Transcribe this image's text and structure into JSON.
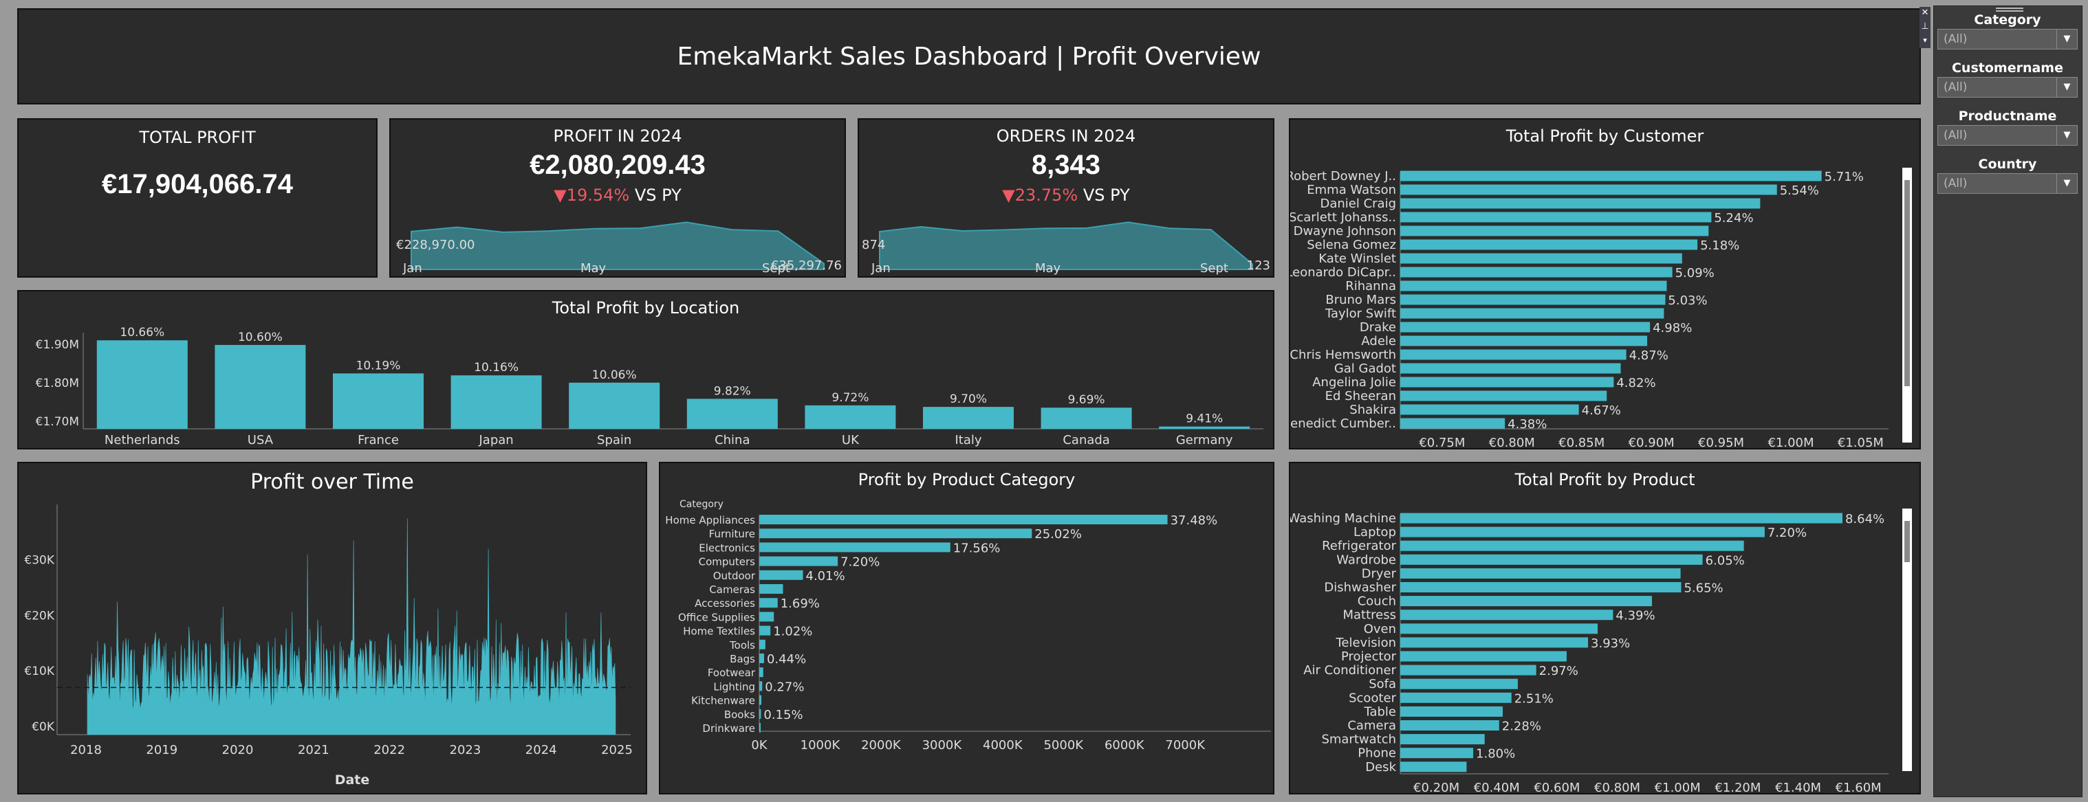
{
  "header": {
    "title": "EmekaMarkt Sales Dashboard | Profit Overview"
  },
  "kpis": {
    "total_profit": {
      "label": "TOTAL PROFIT",
      "value": "€17,904,066.74"
    },
    "profit_2024": {
      "label": "PROFIT IN 2024",
      "value": "€2,080,209.43",
      "delta": "▼19.54%",
      "delta_suffix": "VS PY",
      "start_label": "€228,970.00",
      "end_label": "€35,297.76",
      "axis": [
        "Jan",
        "May",
        "Sept"
      ]
    },
    "orders_2024": {
      "label": "ORDERS IN 2024",
      "value": "8,343",
      "delta": "▼23.75%",
      "delta_suffix": "VS PY",
      "start_label": "874",
      "end_label": "123",
      "axis": [
        "Jan",
        "May",
        "Sept"
      ]
    }
  },
  "location_chart": {
    "title": "Total Profit by Location"
  },
  "customer_chart": {
    "title": "Total Profit by Customer"
  },
  "time_chart": {
    "title": "Profit over Time",
    "xlabel": "Date"
  },
  "category_chart": {
    "title": "Profit by Product Category",
    "header": "Category"
  },
  "product_chart": {
    "title": "Total Profit by Product"
  },
  "filters": {
    "category": {
      "label": "Category",
      "value": "(All)"
    },
    "customer": {
      "label": "Customername",
      "value": "(All)"
    },
    "product": {
      "label": "Productname",
      "value": "(All)"
    },
    "country": {
      "label": "Country",
      "value": "(All)"
    }
  },
  "colors": {
    "accent": "#45b9c8",
    "panel": "#2b2b2b",
    "down": "#ef5a64"
  },
  "chart_data": [
    {
      "id": "location",
      "type": "bar",
      "title": "Total Profit by Location",
      "categories": [
        "Netherlands",
        "USA",
        "France",
        "Japan",
        "Spain",
        "China",
        "UK",
        "Italy",
        "Canada",
        "Germany"
      ],
      "values": [
        1910000,
        1898000,
        1824000,
        1819000,
        1800000,
        1758000,
        1741000,
        1737000,
        1735000,
        1686000
      ],
      "labels": [
        "10.66%",
        "10.60%",
        "10.19%",
        "10.16%",
        "10.06%",
        "9.82%",
        "9.72%",
        "9.70%",
        "9.69%",
        "9.41%"
      ],
      "yticks": [
        "€1.70M",
        "€1.80M",
        "€1.90M"
      ],
      "ylim": [
        1680000,
        1930000
      ]
    },
    {
      "id": "customer",
      "type": "bar",
      "title": "Total Profit by Customer",
      "categories": [
        "Robert Downey J..",
        "Emma Watson",
        "Daniel Craig",
        "Scarlett Johanss..",
        "Dwayne Johnson",
        "Selena Gomez",
        "Kate Winslet",
        "Leonardo DiCapr..",
        "Rihanna",
        "Bruno Mars",
        "Taylor Swift",
        "Drake",
        "Adele",
        "Chris Hemsworth",
        "Gal Gadot",
        "Angelina Jolie",
        "Ed Sheeran",
        "Shakira",
        "Benedict Cumber.."
      ],
      "values": [
        1022000,
        990000,
        978000,
        943000,
        941000,
        933000,
        922000,
        915000,
        911000,
        910000,
        909000,
        899000,
        897000,
        882000,
        878000,
        873000,
        868000,
        848000,
        795000
      ],
      "labels": [
        "5.71%",
        "5.54%",
        "",
        "5.24%",
        "",
        "5.18%",
        "",
        "5.09%",
        "",
        "5.03%",
        "",
        "4.98%",
        "",
        "4.87%",
        "",
        "4.82%",
        "",
        "4.67%",
        "4.38%"
      ],
      "xticks": [
        "€0.75M",
        "€0.80M",
        "€0.85M",
        "€0.90M",
        "€0.95M",
        "€1.00M",
        "€1.05M"
      ],
      "xlim": [
        0.72,
        1.07
      ]
    },
    {
      "id": "time",
      "type": "area",
      "title": "Profit over Time",
      "xlabel": "Date",
      "xticks": [
        "2018",
        "2019",
        "2020",
        "2021",
        "2022",
        "2023",
        "2024",
        "2025"
      ],
      "yticks": [
        "€0K",
        "€10K",
        "€20K",
        "€30K"
      ],
      "ylim": [
        -1500,
        40000
      ],
      "reference_line": 7000
    },
    {
      "id": "category",
      "type": "bar",
      "title": "Profit by Product Category",
      "categories": [
        "Home Appliances",
        "Furniture",
        "Electronics",
        "Computers",
        "Outdoor",
        "Cameras",
        "Accessories",
        "Office Supplies",
        "Home Textiles",
        "Tools",
        "Bags",
        "Footwear",
        "Lighting",
        "Kitchenware",
        "Books",
        "Drinkware"
      ],
      "values": [
        6710000,
        4480000,
        3140000,
        1290000,
        718000,
        390000,
        302000,
        240000,
        183000,
        100000,
        79000,
        65000,
        48000,
        35000,
        27000,
        15000
      ],
      "labels": [
        "37.48%",
        "25.02%",
        "17.56%",
        "7.20%",
        "4.01%",
        "",
        "1.69%",
        "",
        "1.02%",
        "",
        "0.44%",
        "",
        "0.27%",
        "",
        "0.15%",
        ""
      ],
      "xticks": [
        "0K",
        "1000K",
        "2000K",
        "3000K",
        "4000K",
        "5000K",
        "6000K",
        "7000K"
      ],
      "xlim": [
        0,
        7800000
      ]
    },
    {
      "id": "product",
      "type": "bar",
      "title": "Total Profit by Product",
      "categories": [
        "Washing Machine",
        "Laptop",
        "Refrigerator",
        "Wardrobe",
        "Dryer",
        "Dishwasher",
        "Couch",
        "Mattress",
        "Oven",
        "Television",
        "Projector",
        "Air Conditioner",
        "Sofa",
        "Scooter",
        "Table",
        "Camera",
        "Smartwatch",
        "Phone",
        "Desk"
      ],
      "values": [
        1547000,
        1289000,
        1220000,
        1083000,
        1010000,
        1012000,
        915000,
        786000,
        735000,
        703000,
        632000,
        531000,
        470000,
        449000,
        420000,
        408000,
        360000,
        322000,
        300000
      ],
      "labels": [
        "8.64%",
        "7.20%",
        "",
        "6.05%",
        "",
        "5.65%",
        "",
        "4.39%",
        "",
        "3.93%",
        "",
        "2.97%",
        "",
        "2.51%",
        "",
        "2.28%",
        "",
        "1.80%",
        ""
      ],
      "xticks": [
        "€0.20M",
        "€0.40M",
        "€0.60M",
        "€0.80M",
        "€1.00M",
        "€1.20M",
        "€1.40M",
        "€1.60M"
      ],
      "xlim": [
        0.08,
        1.7
      ]
    },
    {
      "id": "spark_profit",
      "type": "area",
      "x": [
        "Jan",
        "Feb",
        "Mar",
        "Apr",
        "May",
        "Jun",
        "Jul",
        "Aug",
        "Sep",
        "Oct"
      ],
      "values": [
        228970,
        255000,
        225000,
        232000,
        246000,
        249000,
        285000,
        240000,
        232000,
        35297.76
      ]
    },
    {
      "id": "spark_orders",
      "type": "area",
      "x": [
        "Jan",
        "Feb",
        "Mar",
        "Apr",
        "May",
        "Jun",
        "Jul",
        "Aug",
        "Sep",
        "Oct"
      ],
      "values": [
        874,
        985,
        890,
        915,
        950,
        955,
        1090,
        950,
        920,
        123
      ]
    }
  ]
}
